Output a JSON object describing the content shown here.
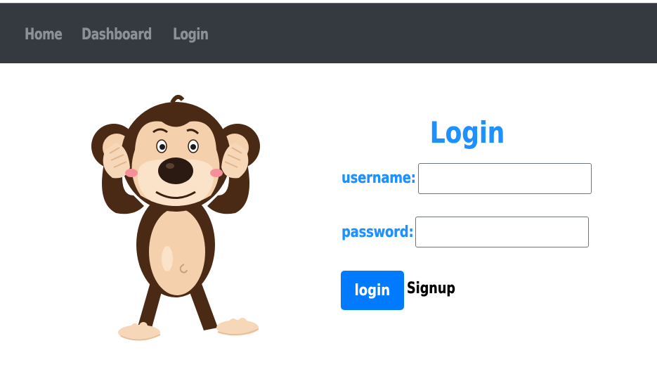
{
  "navbar": {
    "links": [
      {
        "label": "Home"
      },
      {
        "label": "Dashboard"
      },
      {
        "label": "Login"
      }
    ],
    "background_color": "#343a40",
    "link_color": "#8d9196"
  },
  "illustration": {
    "icon": "monkey-mascot"
  },
  "form": {
    "title": "Login",
    "username_label": "username:",
    "username_value": "",
    "password_label": "password:",
    "password_value": "",
    "submit_label": "login",
    "signup_label": "Signup",
    "accent_color": "#1e90ff",
    "button_color": "#007bff"
  }
}
